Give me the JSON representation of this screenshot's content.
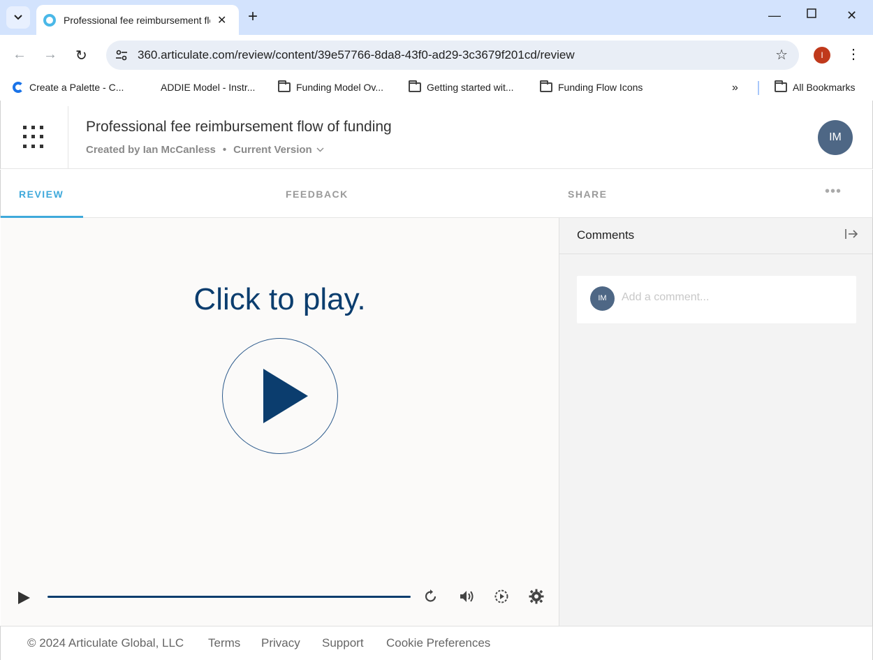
{
  "browser": {
    "tab_title": "Professional fee reimbursement flow of funding",
    "url": "360.articulate.com/review/content/39e57766-8da8-43f0-ad29-3c3679f201cd/review",
    "profile_initial": "I",
    "bookmarks": [
      {
        "label": "Create a Palette - C...",
        "icon": "coolors-logo-icon"
      },
      {
        "label": "ADDIE Model - Instr...",
        "icon": "none"
      },
      {
        "label": "Funding Model Ov...",
        "icon": "folder-icon"
      },
      {
        "label": "Getting started wit...",
        "icon": "folder-icon"
      },
      {
        "label": "Funding Flow Icons",
        "icon": "folder-icon"
      }
    ],
    "all_bookmarks_label": "All Bookmarks"
  },
  "header": {
    "title": "Professional fee reimbursement flow of funding",
    "created_by": "Created by Ian McCanless",
    "separator": "•",
    "version": "Current Version",
    "avatar_initials": "IM"
  },
  "tabs": {
    "review": "REVIEW",
    "feedback": "FEEDBACK",
    "share": "SHARE"
  },
  "player": {
    "prompt": "Click to play.",
    "progress": 1.0
  },
  "comments": {
    "title": "Comments",
    "avatar_initials": "IM",
    "placeholder": "Add a comment..."
  },
  "footer": {
    "copyright": "© 2024 Articulate Global, LLC",
    "terms": "Terms",
    "privacy": "Privacy",
    "support": "Support",
    "cookie": "Cookie Preferences"
  },
  "colors": {
    "accent": "#3fa9db",
    "navy": "#0b3d6e",
    "avatar": "#4e6785"
  }
}
